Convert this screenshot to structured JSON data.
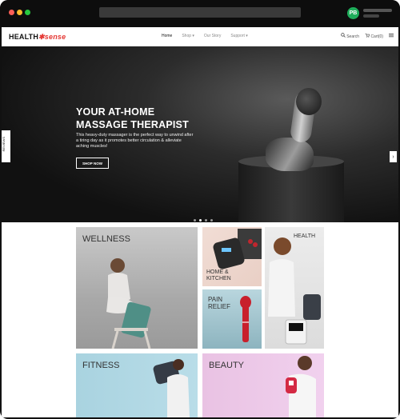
{
  "browser": {
    "profile_initials": "PB",
    "colors": {
      "close": "#ff5f57",
      "minimize": "#febc2e",
      "maximize": "#28c840",
      "profile": "#1fae5b"
    }
  },
  "nav": {
    "logo_main": "HEALTH",
    "logo_accent": "sense",
    "links": [
      "Home",
      "Shop ▾",
      "Our Story",
      "Support ▾"
    ],
    "search_label": "Search",
    "cart_label": "Cart(0)",
    "menu_icon": "hamburger-icon"
  },
  "hero": {
    "title": "YOUR AT-HOME MASSAGE THERAPIST",
    "subtitle": "This heavy-duty massager is the perfect way to unwind after a tiring day as it promotes better circulation & alleviate aching muscles!",
    "cta": "SHOP NOW",
    "reviews_tab": "REVIEWS",
    "next_arrow": "›",
    "slides_total": 4,
    "slide_active": 2
  },
  "categories": {
    "wellness": "WELLNESS",
    "home_kitchen": "HOME & KITCHEN",
    "health": "HEALTH",
    "pain_relief": "PAIN RELIEF",
    "fitness": "FITNESS",
    "beauty": "BEAUTY"
  }
}
